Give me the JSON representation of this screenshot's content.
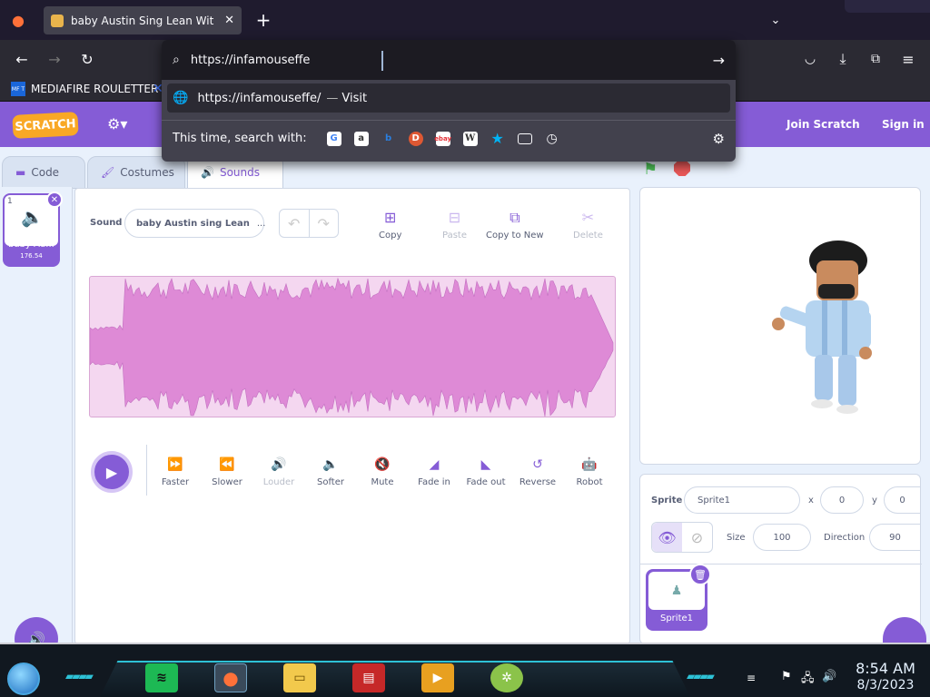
{
  "browser": {
    "tab_title": "baby Austin Sing Lean Wit Me c",
    "url_text": "https://infamouseffe",
    "suggestion_url": "https://infamouseffe/",
    "suggestion_sep": "—",
    "suggestion_action": "Visit",
    "search_with_label": "This time, search with:",
    "search_engines": [
      "google",
      "amazon",
      "bing",
      "duckduckgo",
      "ebay",
      "wikipedia",
      "bookmarks",
      "tabs",
      "history"
    ],
    "bookmark_label": "MEDIAFIRE ROULETTER",
    "bookmark_icon_text": "MF T"
  },
  "scratch": {
    "logo_text": "SCRATCH",
    "join_label": "Join Scratch",
    "signin_label": "Sign in",
    "tabs": {
      "code": "Code",
      "costumes": "Costumes",
      "sounds": "Sounds"
    },
    "sound_tile": {
      "index": "1",
      "name": "baby Au...",
      "duration": "176.54"
    },
    "editor": {
      "sound_label": "Sound",
      "sound_name": "baby Austin sing Lean",
      "sound_name_ellipsis": "...",
      "tools": {
        "copy": "Copy",
        "paste": "Paste",
        "copy_to_new": "Copy to New",
        "delete": "Delete"
      },
      "effects": {
        "faster": "Faster",
        "slower": "Slower",
        "louder": "Louder",
        "softer": "Softer",
        "mute": "Mute",
        "fade_in": "Fade in",
        "fade_out": "Fade out",
        "reverse": "Reverse",
        "robot": "Robot"
      }
    },
    "sprite_panel": {
      "sprite_label": "Sprite",
      "sprite_name": "Sprite1",
      "x_label": "x",
      "x_value": "0",
      "y_label": "y",
      "y_value": "0",
      "size_label": "Size",
      "size_value": "100",
      "direction_label": "Direction",
      "direction_value": "90",
      "tile_name": "Sprite1"
    },
    "colors": {
      "primary": "#855cd6",
      "wave": "#de8ad6",
      "wave_bg": "#f4d7f0"
    }
  },
  "taskbar": {
    "time": "8:54 AM",
    "date": "8/3/2023",
    "apps": [
      "spotify",
      "firefox",
      "file-explorer",
      "news",
      "media-player",
      "lime-app"
    ]
  }
}
